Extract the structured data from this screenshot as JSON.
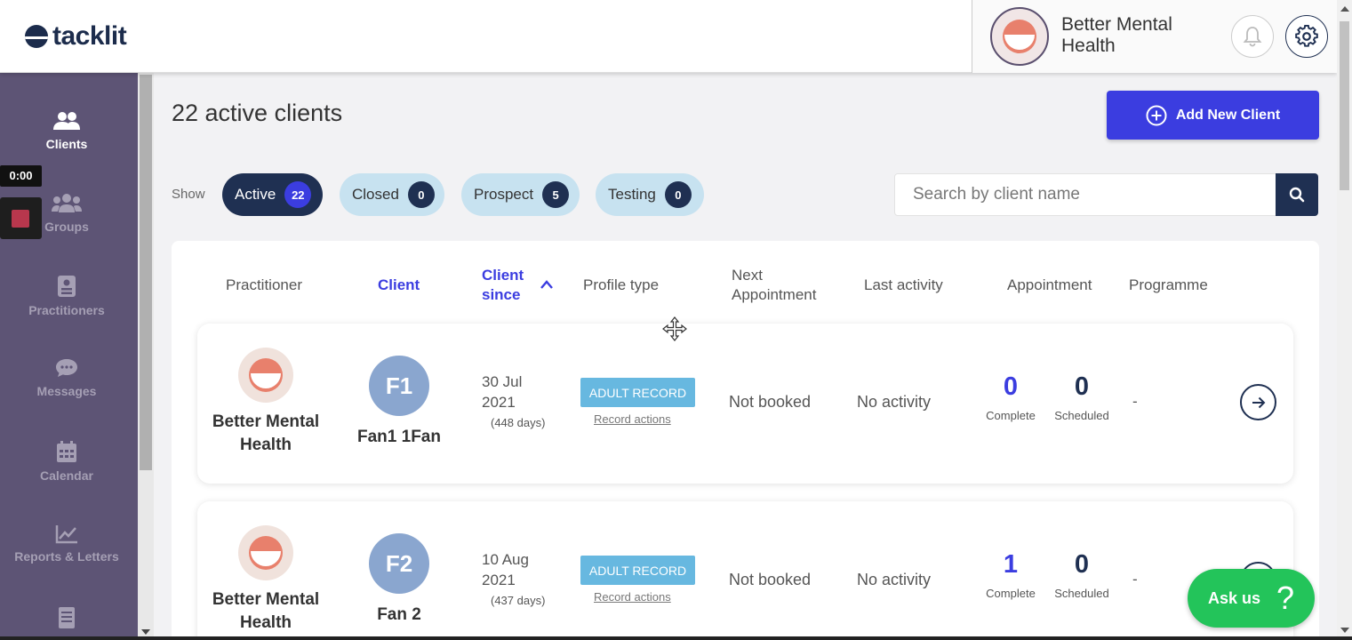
{
  "header": {
    "logo_text": "tacklit",
    "user_name": "Better Mental Health"
  },
  "sidebar": {
    "timer": "0:00",
    "items": [
      {
        "label": "Clients"
      },
      {
        "label": "Groups"
      },
      {
        "label": "Practitioners"
      },
      {
        "label": "Messages"
      },
      {
        "label": "Calendar"
      },
      {
        "label": "Reports & Letters"
      }
    ]
  },
  "main": {
    "title": "22 active clients",
    "add_button": "Add New Client",
    "show_label": "Show",
    "filters": [
      {
        "label": "Active",
        "count": "22"
      },
      {
        "label": "Closed",
        "count": "0"
      },
      {
        "label": "Prospect",
        "count": "5"
      },
      {
        "label": "Testing",
        "count": "0"
      }
    ],
    "search_placeholder": "Search by client name"
  },
  "table": {
    "headers": {
      "practitioner": "Practitioner",
      "client": "Client",
      "client_since_1": "Client",
      "client_since_2": "since",
      "profile_type": "Profile type",
      "next_appointment_1": "Next",
      "next_appointment_2": "Appointment",
      "last_activity": "Last activity",
      "appointment": "Appointment",
      "programme": "Programme"
    },
    "rows": [
      {
        "practitioner": "Better Mental Health",
        "initials": "F1",
        "client": "Fan1 1Fan",
        "since_date_1": "30 Jul",
        "since_date_2": "2021",
        "since_days": "(448 days)",
        "profile_type": "ADULT RECORD",
        "record_actions": "Record actions",
        "next_appointment": "Not booked",
        "last_activity": "No activity",
        "complete": "0",
        "complete_label": "Complete",
        "scheduled": "0",
        "scheduled_label": "Scheduled",
        "programme": "-"
      },
      {
        "practitioner": "Better Mental Health",
        "initials": "F2",
        "client": "Fan 2",
        "since_date_1": "10 Aug",
        "since_date_2": "2021",
        "since_days": "(437 days)",
        "profile_type": "ADULT RECORD",
        "record_actions": "Record actions",
        "next_appointment": "Not booked",
        "last_activity": "No activity",
        "complete": "1",
        "complete_label": "Complete",
        "scheduled": "0",
        "scheduled_label": "Scheduled",
        "programme": "-"
      }
    ]
  },
  "help": {
    "label": "Ask us",
    "glyph": "?"
  },
  "colors": {
    "sidebar": "#5d5475",
    "primary": "#3b3de0",
    "navy": "#1f3052",
    "badge": "#67b8e0",
    "help": "#23c45a"
  }
}
